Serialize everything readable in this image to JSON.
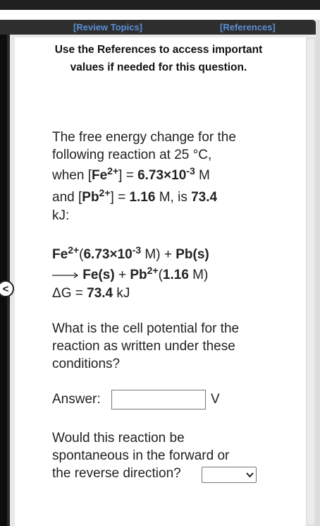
{
  "toolbar": {
    "review_topics": "[Review Topics]",
    "references": "[References]"
  },
  "notice": {
    "text": "Use the References to access important values if needed for this question."
  },
  "intro": {
    "line1": "The free energy change for the",
    "line2": "following reaction at 25 °C,",
    "line3_pre": "when [",
    "fe_species": "Fe",
    "fe_charge": "2+",
    "line3_mid": "] = ",
    "fe_conc_base": "6.73×10",
    "fe_conc_exp": "-3",
    "line3_unit": " M",
    "line4_pre": "and [",
    "pb_species": "Pb",
    "pb_charge": "2+",
    "line4_mid": "] = ",
    "pb_conc": "1.16",
    "line4_unit": " M, is ",
    "dg_value": "73.4",
    "line5": "kJ:"
  },
  "reaction": {
    "r1_fe": "Fe",
    "r1_fe_charge": "2+",
    "r1_open": "(",
    "r1_conc_base": "6.73×10",
    "r1_conc_exp": "-3",
    "r1_close": " M) + ",
    "r1_pb_solid": "Pb(s)",
    "r2_fe_solid": "Fe(s)",
    "r2_plus": " + ",
    "r2_pb": "Pb",
    "r2_pb_charge": "2+",
    "r2_open": "(",
    "r2_conc": "1.16",
    "r2_close": " M)",
    "dg_label": "ΔG = ",
    "dg_value": "73.4",
    "dg_unit": " kJ"
  },
  "question1": {
    "line1": "What is the cell potential for the",
    "line2": "reaction as written under these",
    "line3": "conditions?"
  },
  "answer": {
    "label": "Answer:",
    "value": "",
    "unit": "V"
  },
  "question2": {
    "line1": "Would this reaction be",
    "line2": "spontaneous in the forward or",
    "line3": "the reverse direction?"
  },
  "direction_select": {
    "selected": ""
  },
  "icons": {
    "collapse": "chevron-left-icon",
    "dropdown": "chevron-down-icon",
    "reaction_arrow": "right-arrow-icon"
  }
}
